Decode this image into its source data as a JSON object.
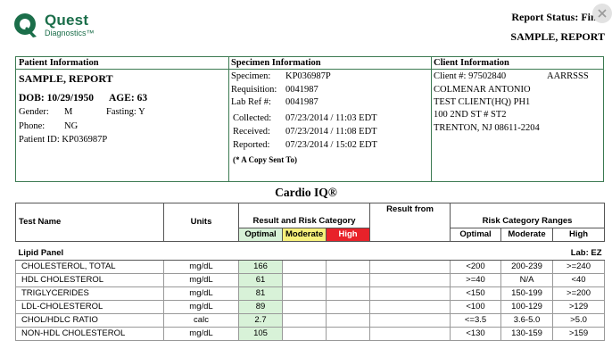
{
  "header": {
    "logo_brand": "Quest",
    "logo_sub": "Diagnostics",
    "logo_tm": "™",
    "report_status": "Report Status: Final",
    "report_name": "SAMPLE, REPORT"
  },
  "patient": {
    "heading": "Patient Information",
    "name": "SAMPLE, REPORT",
    "dob": "DOB: 10/29/1950",
    "age": "AGE: 63",
    "gender_label": "Gender:",
    "gender": "M",
    "fasting_label": "Fasting: Y",
    "phone_label": "Phone:",
    "phone": "NG",
    "patient_id": "Patient ID: KP036987P"
  },
  "specimen": {
    "heading": "Specimen Information",
    "specimen_label": "Specimen:",
    "specimen": "KP036987P",
    "requisition_label": "Requisition:",
    "requisition": "0041987",
    "labref_label": "Lab Ref #:",
    "labref": "0041987",
    "collected_label": "Collected:",
    "collected": "07/23/2014 / 11:03 EDT",
    "received_label": "Received:",
    "received": "07/23/2014 / 11:08 EDT",
    "reported_label": "Reported:",
    "reported": "07/23/2014 / 15:02 EDT",
    "copy_note": "(* A Copy Sent To)"
  },
  "client": {
    "heading": "Client Information",
    "client_no": "Client #: 97502840",
    "client_code": "AARRSSS",
    "line1": "COLMENAR ANTONIO",
    "line2": "TEST CLIENT(HQ) PH1",
    "line3": "100 2ND ST # ST2",
    "line4": "TRENTON, NJ 08611-2204"
  },
  "cardio": {
    "title": "Cardio IQ®",
    "col_test": "Test Name",
    "col_units": "Units",
    "col_result": "Result and Risk Category",
    "col_result_from": "Result from",
    "col_ranges": "Risk Category Ranges",
    "cat_optimal": "Optimal",
    "cat_moderate": "Moderate",
    "cat_high": "High",
    "panel": "Lipid Panel",
    "lab": "Lab: EZ",
    "colors": {
      "optimal": "#d6f1d6",
      "moderate": "#f6f07a",
      "high": "#e8222a"
    },
    "rows": [
      {
        "name": "CHOLESTEROL, TOTAL",
        "units": "mg/dL",
        "value": "166",
        "optimal": "<200",
        "moderate": "200-239",
        "high": ">=240"
      },
      {
        "name": "HDL CHOLESTEROL",
        "units": "mg/dL",
        "value": "61",
        "optimal": ">=40",
        "moderate": "N/A",
        "high": "<40"
      },
      {
        "name": "TRIGLYCERIDES",
        "units": "mg/dL",
        "value": "81",
        "optimal": "<150",
        "moderate": "150-199",
        "high": ">=200"
      },
      {
        "name": "LDL-CHOLESTEROL",
        "units": "mg/dL",
        "value": "89",
        "optimal": "<100",
        "moderate": "100-129",
        "high": ">129"
      },
      {
        "name": "CHOL/HDLC RATIO",
        "units": "calc",
        "value": "2.7",
        "optimal": "<=3.5",
        "moderate": "3.6-5.0",
        "high": ">5.0"
      },
      {
        "name": "NON-HDL CHOLESTEROL",
        "units": "mg/dL",
        "value": "105",
        "optimal": "<130",
        "moderate": "130-159",
        "high": ">159"
      }
    ]
  }
}
